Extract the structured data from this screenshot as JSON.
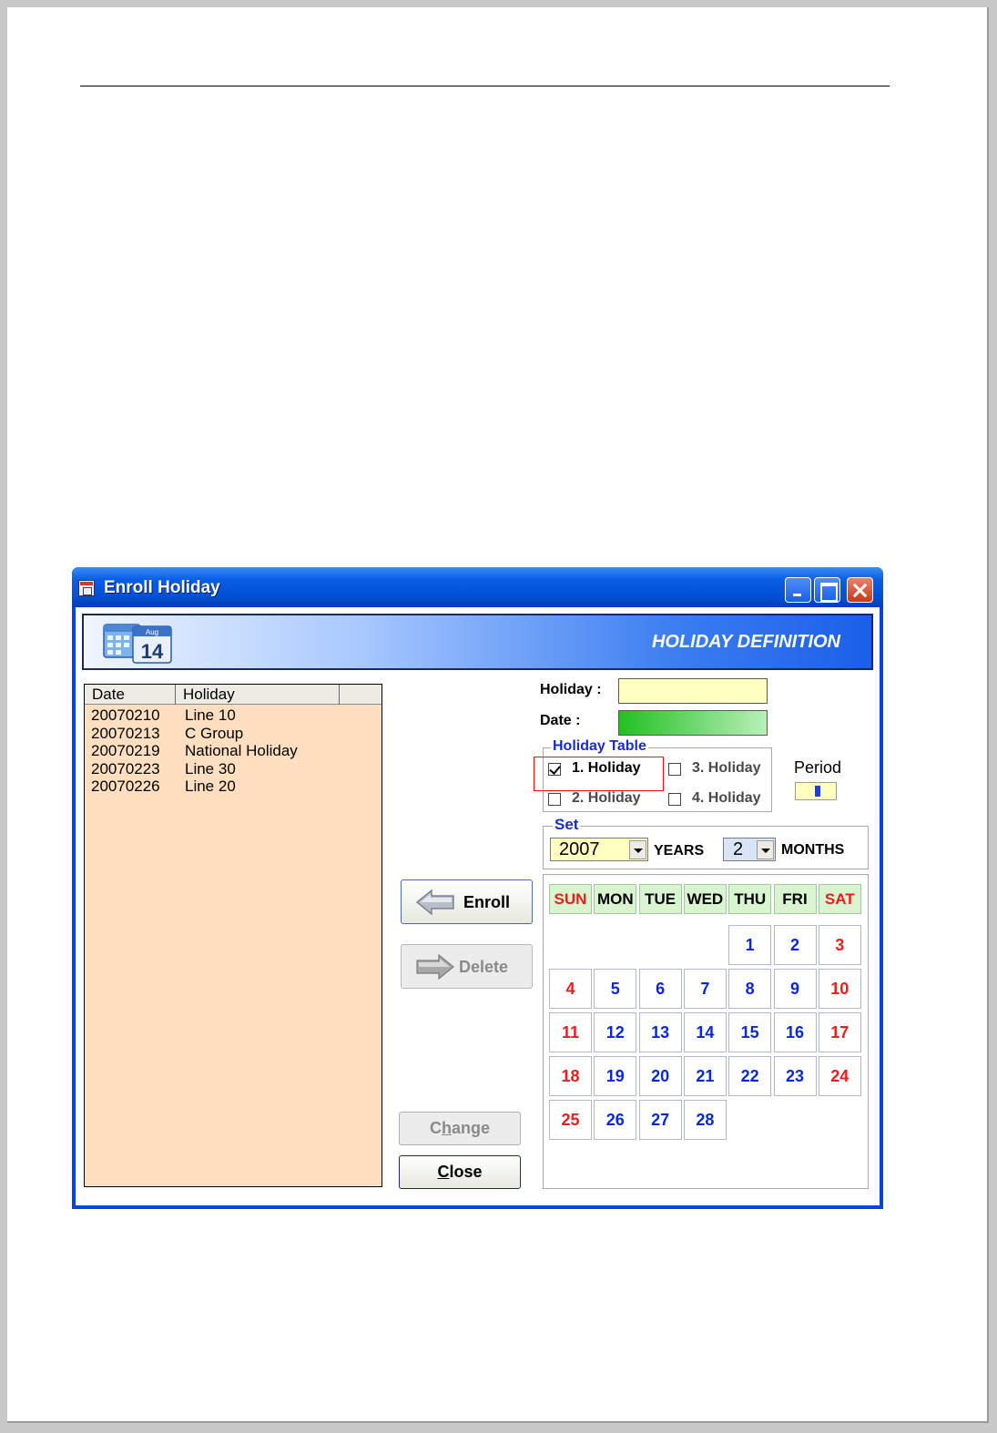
{
  "window": {
    "title": "Enroll Holiday"
  },
  "banner": {
    "title": "HOLIDAY DEFINITION",
    "icon_text": "Aug",
    "icon_number": "14"
  },
  "list": {
    "columns": [
      "Date",
      "Holiday",
      ""
    ],
    "rows": [
      {
        "date": "20070210",
        "holiday": "Line 10"
      },
      {
        "date": "20070213",
        "holiday": "C Group"
      },
      {
        "date": "20070219",
        "holiday": "National Holiday"
      },
      {
        "date": "20070223",
        "holiday": "Line 30"
      },
      {
        "date": "20070226",
        "holiday": "Line 20"
      }
    ]
  },
  "form": {
    "holiday_label": "Holiday :",
    "holiday_value": "",
    "date_label": "Date :",
    "field_colors": {
      "holiday": "#ffffc0",
      "date": "#22c022"
    }
  },
  "holiday_table": {
    "title": "Holiday Table",
    "options": [
      {
        "label": "1. Holiday",
        "checked": true
      },
      {
        "label": "2. Holiday",
        "checked": false
      },
      {
        "label": "3. Holiday",
        "checked": false
      },
      {
        "label": "4. Holiday",
        "checked": false
      }
    ]
  },
  "period": {
    "label": "Period",
    "value": ""
  },
  "set": {
    "title": "Set",
    "year": "2007",
    "years_label": "YEARS",
    "month": "2",
    "months_label": "MONTHS"
  },
  "buttons": {
    "enroll": "Enroll",
    "delete": "Delete",
    "change": "Change",
    "close": "Close"
  },
  "calendar": {
    "days": [
      "SUN",
      "MON",
      "TUE",
      "WED",
      "THU",
      "FRI",
      "SAT"
    ],
    "day_colors": [
      "red",
      "black",
      "black",
      "black",
      "black",
      "black",
      "red"
    ],
    "first_weekday": 4,
    "month_days": 28,
    "weekend_color": "#ee1c1c",
    "weekday_color": "#0a28d8"
  }
}
